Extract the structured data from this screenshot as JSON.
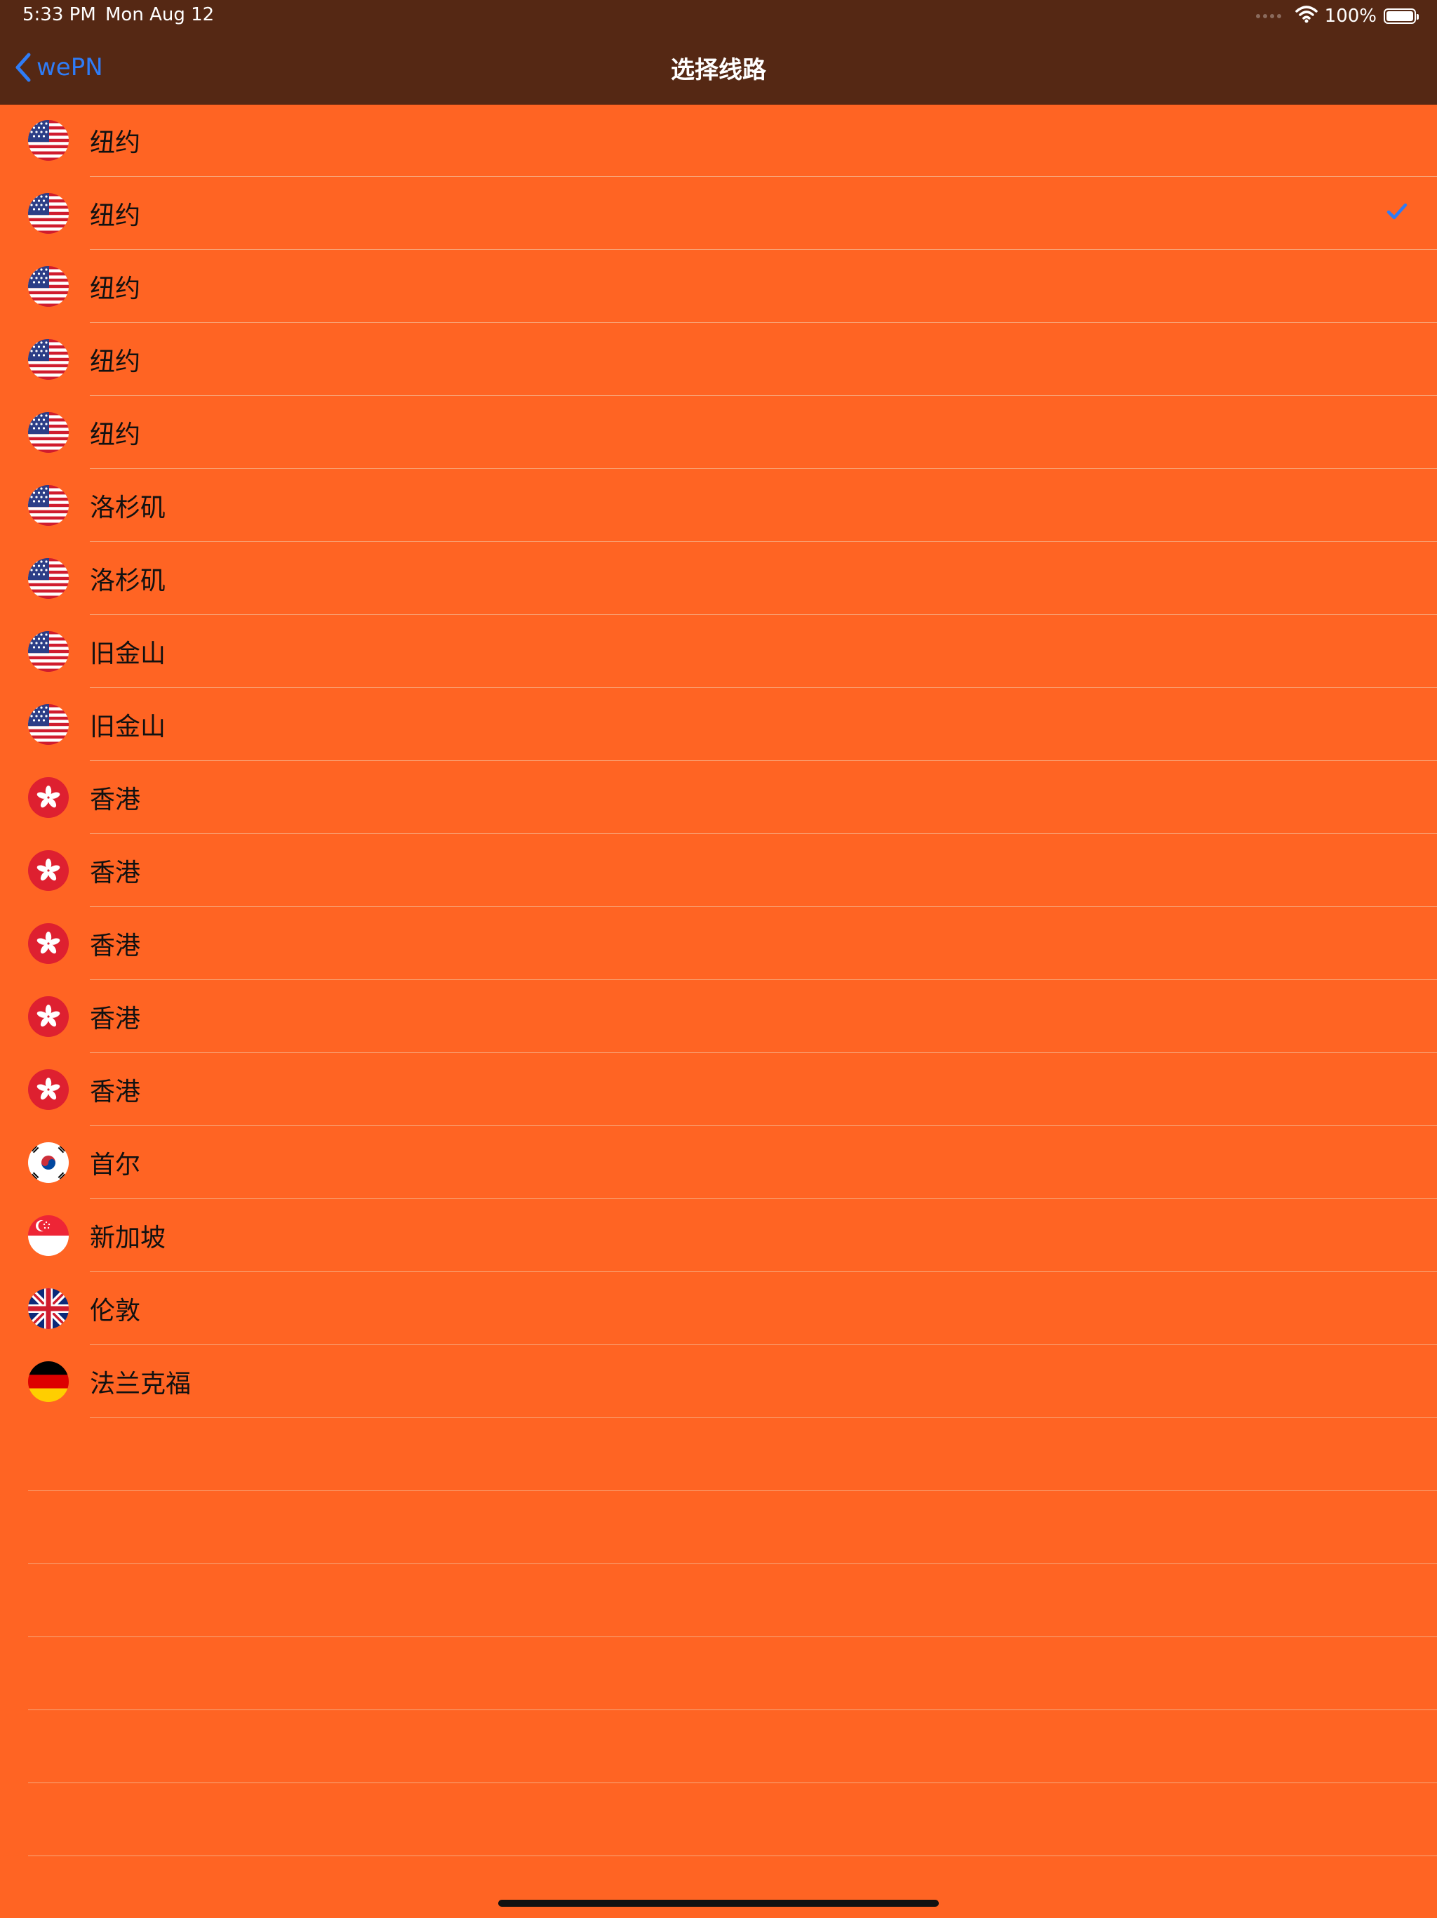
{
  "status_bar": {
    "time": "5:33 PM",
    "date": "Mon Aug 12",
    "battery": "100%"
  },
  "nav": {
    "back_label": "wePN",
    "title": "选择线路"
  },
  "colors": {
    "background": "#FF6423",
    "nav": "#552814",
    "accent": "#2F7CF6"
  },
  "servers": [
    {
      "label": "纽约",
      "flag": "us-flag-icon",
      "selected": false
    },
    {
      "label": "纽约",
      "flag": "us-flag-icon",
      "selected": true
    },
    {
      "label": "纽约",
      "flag": "us-flag-icon",
      "selected": false
    },
    {
      "label": "纽约",
      "flag": "us-flag-icon",
      "selected": false
    },
    {
      "label": "纽约",
      "flag": "us-flag-icon",
      "selected": false
    },
    {
      "label": "洛杉矶",
      "flag": "us-flag-icon",
      "selected": false
    },
    {
      "label": "洛杉矶",
      "flag": "us-flag-icon",
      "selected": false
    },
    {
      "label": "旧金山",
      "flag": "us-flag-icon",
      "selected": false
    },
    {
      "label": "旧金山",
      "flag": "us-flag-icon",
      "selected": false
    },
    {
      "label": "香港",
      "flag": "hk-flag-icon",
      "selected": false
    },
    {
      "label": "香港",
      "flag": "hk-flag-icon",
      "selected": false
    },
    {
      "label": "香港",
      "flag": "hk-flag-icon",
      "selected": false
    },
    {
      "label": "香港",
      "flag": "hk-flag-icon",
      "selected": false
    },
    {
      "label": "香港",
      "flag": "hk-flag-icon",
      "selected": false
    },
    {
      "label": "首尔",
      "flag": "kr-flag-icon",
      "selected": false
    },
    {
      "label": "新加坡",
      "flag": "sg-flag-icon",
      "selected": false
    },
    {
      "label": "伦敦",
      "flag": "uk-flag-icon",
      "selected": false
    },
    {
      "label": "法兰克福",
      "flag": "de-flag-icon",
      "selected": false
    }
  ]
}
